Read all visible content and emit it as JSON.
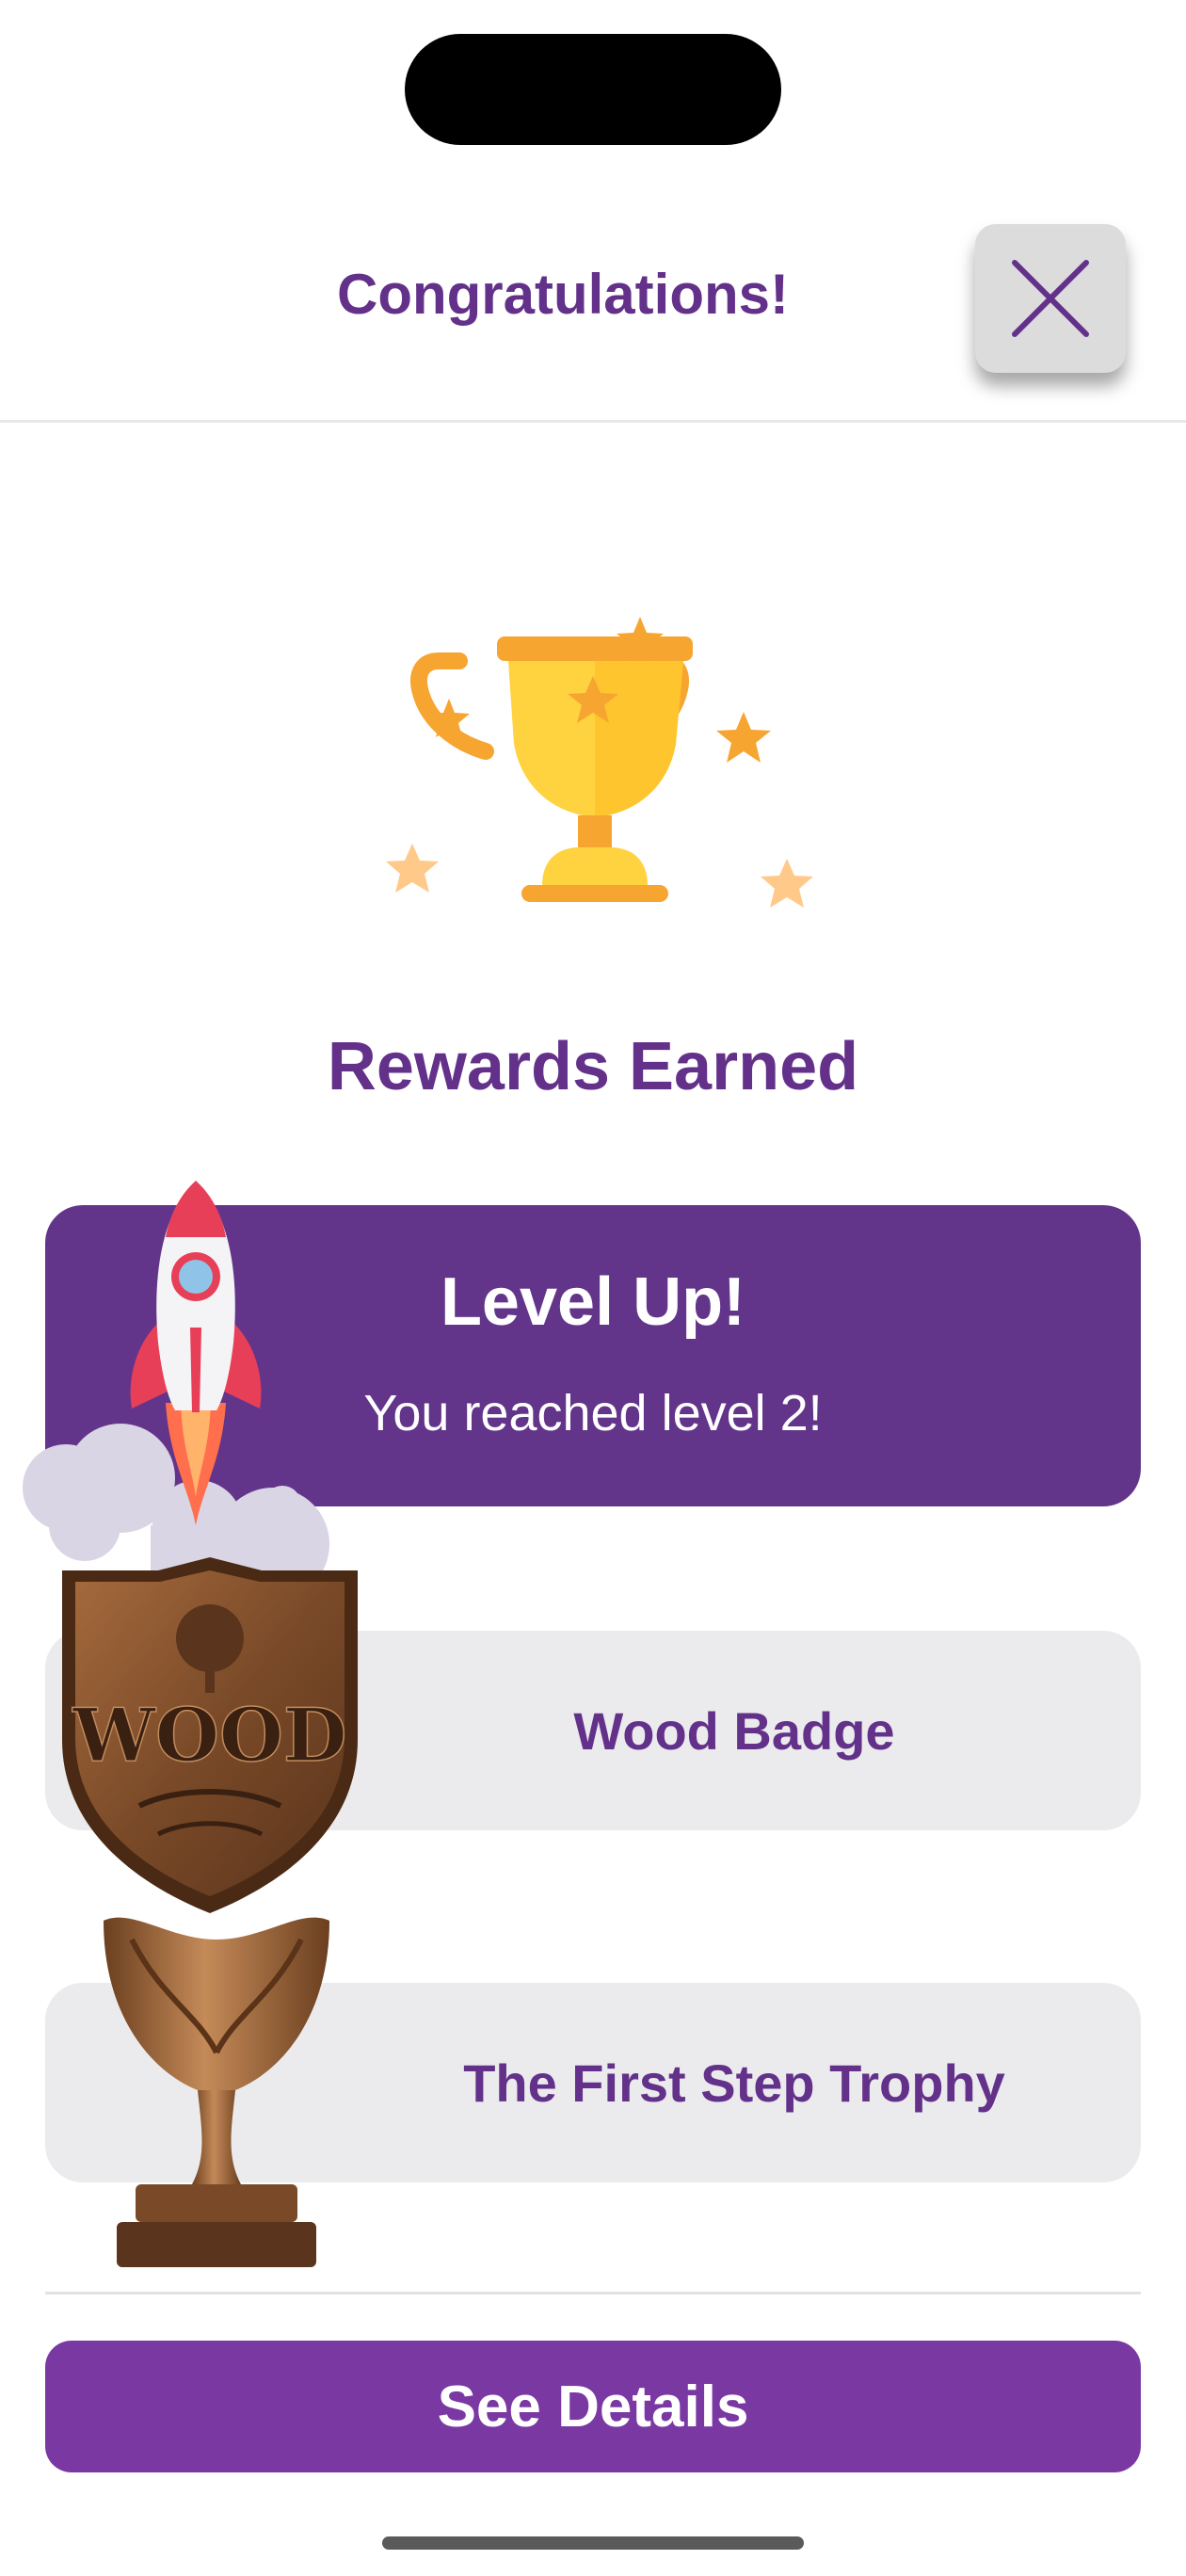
{
  "header": {
    "title": "Congratulations!",
    "close_icon": "close-icon"
  },
  "hero": {
    "icon": "trophy-with-stars-icon",
    "title": "Rewards Earned"
  },
  "rewards": [
    {
      "title": "Level Up!",
      "subtitle": "You reached level 2!",
      "icon": "rocket-icon"
    },
    {
      "title": "Wood Badge",
      "icon": "wood-badge-icon",
      "badge_text": "WOOD"
    },
    {
      "title": "The First Step Trophy",
      "icon": "wooden-trophy-icon"
    }
  ],
  "footer": {
    "button_label": "See Details"
  },
  "colors": {
    "accent": "#63318a",
    "card_primary": "#63358a",
    "card_secondary": "#ebebed",
    "button": "#7a38a3",
    "trophy_gold": "#ffc933",
    "star_orange": "#f7a531"
  }
}
